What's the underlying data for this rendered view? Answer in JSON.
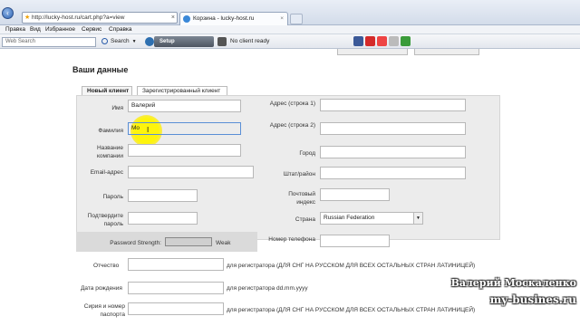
{
  "browser": {
    "address": "http://lucky-host.ru/cart.php?a=view",
    "tab_title": "Корзина - lucky-host.ru",
    "menu": [
      "Правка",
      "Вид",
      "Избранное",
      "Сервис",
      "Справка"
    ],
    "search_placeholder": "Web Search",
    "search_label": "Search",
    "setup_label": "Setup",
    "status_text": "No client ready"
  },
  "page": {
    "title": "Ваши данные",
    "tabs": [
      "Новый клиент",
      "Зарегистрированный клиент"
    ],
    "left_fields": [
      {
        "label": "Имя",
        "value": "Валерий"
      },
      {
        "label": "Фамилия",
        "value": "Mo"
      },
      {
        "label": "Название компании",
        "value": ""
      },
      {
        "label": "Email-адрес",
        "value": ""
      },
      {
        "label": "Пароль",
        "value": ""
      },
      {
        "label": "Подтвердите пароль",
        "value": ""
      }
    ],
    "right_fields": [
      {
        "label": "Адрес (строка 1)",
        "value": ""
      },
      {
        "label": "Адрес (строка 2)",
        "value": ""
      },
      {
        "label": "Город",
        "value": ""
      },
      {
        "label": "Штат/район",
        "value": ""
      },
      {
        "label": "Почтовый индекс",
        "value": ""
      },
      {
        "label": "Страна",
        "value": "Russian Federation"
      },
      {
        "label": "Номер телефона",
        "value": ""
      }
    ],
    "password_strength_label": "Password Strength:",
    "password_strength_value": "Weak",
    "extra_fields": [
      {
        "label": "Отчество",
        "note": "для регистратора (ДЛЯ СНГ НА РУССКОМ ДЛЯ ВСЕХ ОСТАЛЬНЫХ СТРАН ЛАТИНИЦЕЙ)"
      },
      {
        "label": "Дата рождения",
        "note": "для регистратора dd.mm.yyyy"
      },
      {
        "label": "Сирия и номер паспорта",
        "note": "для регистратора (ДЛЯ СНГ НА РУССКОМ ДЛЯ ВСЕХ ОСТАЛЬНЫХ СТРАН ЛАТИНИЦЕЙ)"
      }
    ]
  },
  "watermark": {
    "line1": "Валерий Москаленко",
    "line2": "my-busines.ru"
  }
}
